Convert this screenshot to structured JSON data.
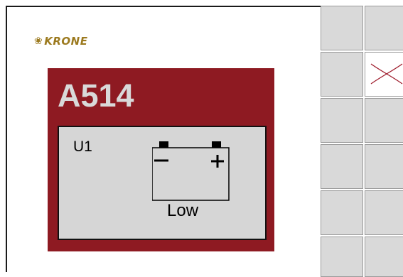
{
  "brand": {
    "name": "KRONE",
    "icon": "krone-crown-icon",
    "color": "#9c7a1f"
  },
  "alarm": {
    "code": "A514",
    "unit": "U1",
    "icon": "battery-icon",
    "status": "Low",
    "panel_color": "#8e1a22"
  },
  "softkeys": [
    {
      "name": "softkey-1",
      "icon": ""
    },
    {
      "name": "softkey-2",
      "icon": ""
    },
    {
      "name": "softkey-3",
      "icon": ""
    },
    {
      "name": "softkey-close",
      "icon": "close-icon"
    },
    {
      "name": "softkey-5",
      "icon": ""
    },
    {
      "name": "softkey-6",
      "icon": ""
    },
    {
      "name": "softkey-7",
      "icon": ""
    },
    {
      "name": "softkey-8",
      "icon": ""
    },
    {
      "name": "softkey-9",
      "icon": ""
    },
    {
      "name": "softkey-10",
      "icon": ""
    },
    {
      "name": "softkey-11",
      "icon": ""
    },
    {
      "name": "softkey-12",
      "icon": ""
    }
  ]
}
